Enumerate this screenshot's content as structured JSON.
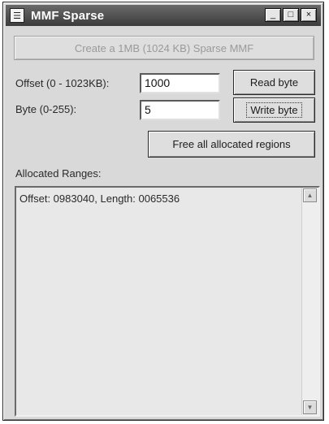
{
  "window": {
    "title": "MMF Sparse",
    "controls": {
      "minimize": "_",
      "maximize": "□",
      "close": "×"
    }
  },
  "buttons": {
    "create": "Create a 1MB (1024 KB) Sparse MMF",
    "read": "Read byte",
    "write": "Write byte",
    "free": "Free all allocated regions"
  },
  "fields": {
    "offset_label": "Offset (0 - 1023KB):",
    "offset_value": "1000",
    "byte_label": "Byte (0-255):",
    "byte_value": "5"
  },
  "ranges": {
    "label": "Allocated Ranges:",
    "items": [
      "Offset: 0983040, Length: 0065536"
    ]
  },
  "icons": {
    "app": "document-icon",
    "scroll_up": "arrow-up-icon",
    "scroll_down": "arrow-down-icon"
  }
}
